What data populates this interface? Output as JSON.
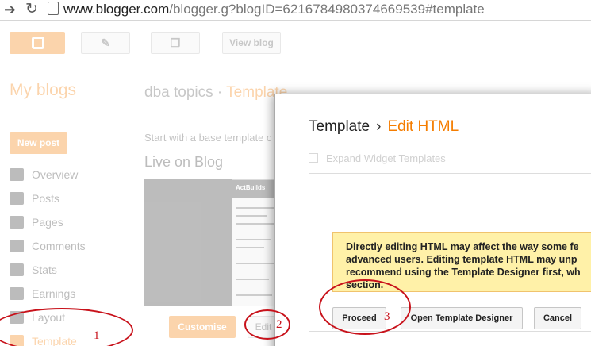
{
  "browser": {
    "url_host": "www.blogger.com",
    "url_rest": "/blogger.g?blogID=6216784980374669539#template"
  },
  "header": {
    "view_blog": "View blog"
  },
  "sidebar": {
    "title": "My blogs",
    "new_post": "New post",
    "items": [
      {
        "label": "Overview",
        "icon": "home-icon"
      },
      {
        "label": "Posts",
        "icon": "posts-icon"
      },
      {
        "label": "Pages",
        "icon": "pages-icon"
      },
      {
        "label": "Comments",
        "icon": "comments-icon"
      },
      {
        "label": "Stats",
        "icon": "stats-icon"
      },
      {
        "label": "Earnings",
        "icon": "trophy-icon"
      },
      {
        "label": "Layout",
        "icon": "layout-icon"
      },
      {
        "label": "Template",
        "icon": "template-icon"
      }
    ]
  },
  "main": {
    "blog_name": "dba topics",
    "crumb_sep": "·",
    "crumb": "Template",
    "base_text": "Start with a base template c",
    "live_title": "Live on Blog",
    "thumb_brand": "ActBuilds",
    "customise": "Customise",
    "edit": "Edit"
  },
  "dialog": {
    "title": "Template",
    "separator": "›",
    "subtitle": "Edit HTML",
    "expand_label": "Expand Widget Templates",
    "warning_lines": [
      "Directly editing HTML may affect the way some fe",
      "advanced users. Editing template HTML may unp",
      "recommend using the Template Designer first, wh",
      "section."
    ],
    "proceed": "Proceed",
    "open_designer": "Open Template Designer",
    "cancel": "Cancel"
  },
  "annotations": [
    "1",
    "2",
    "3"
  ],
  "colors": {
    "accent": "#f57d00",
    "warning_bg": "#fff1a8",
    "annotation": "#c8121b"
  }
}
